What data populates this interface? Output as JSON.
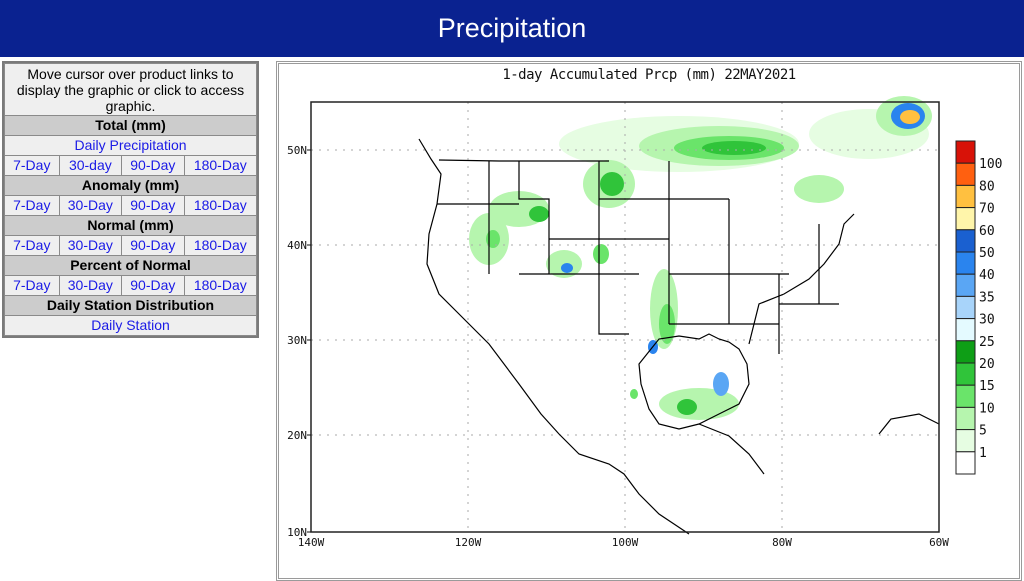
{
  "header": {
    "title": "Precipitation"
  },
  "nav": {
    "intro": "Move cursor over product links to display the graphic or click to access graphic.",
    "sections": [
      {
        "title": "Total (mm)",
        "main_link": "Daily Precipitation",
        "links": [
          "7-Day",
          "30-day",
          "90-Day",
          "180-Day"
        ]
      },
      {
        "title": "Anomaly (mm)",
        "links": [
          "7-Day",
          "30-Day",
          "90-Day",
          "180-Day"
        ]
      },
      {
        "title": "Normal (mm)",
        "links": [
          "7-Day",
          "30-Day",
          "90-Day",
          "180-Day"
        ]
      },
      {
        "title": "Percent of Normal",
        "links": [
          "7-Day",
          "30-Day",
          "90-Day",
          "180-Day"
        ]
      },
      {
        "title": "Daily Station Distribution",
        "main_link": "Daily Station"
      }
    ]
  },
  "map": {
    "title": "1-day Accumulated Prcp (mm) 22MAY2021",
    "lat_labels": [
      "50N",
      "40N",
      "30N",
      "20N",
      "10N"
    ],
    "lon_labels": [
      "140W",
      "120W",
      "100W",
      "80W",
      "60W"
    ],
    "colorbar": {
      "labels": [
        "100",
        "80",
        "70",
        "60",
        "50",
        "40",
        "35",
        "30",
        "25",
        "20",
        "15",
        "10",
        "5",
        "1"
      ],
      "colors": [
        "#d81208",
        "#ff6010",
        "#ffc040",
        "#fff5aa",
        "#1a60d0",
        "#2a84ee",
        "#5aa6f4",
        "#a8d4fa",
        "#e4faff",
        "#0e9e16",
        "#30c43a",
        "#6ae46a",
        "#b6f5ae",
        "#e6fde2",
        "#ffffff"
      ]
    }
  }
}
